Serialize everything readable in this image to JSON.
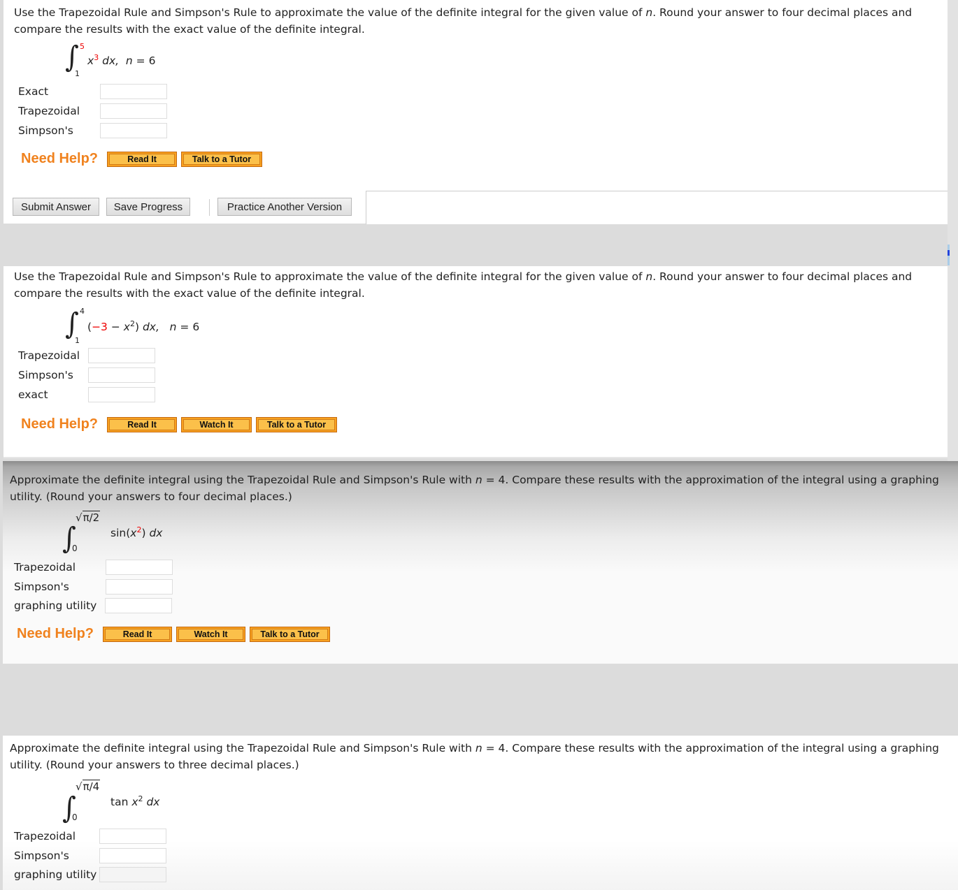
{
  "questions": [
    {
      "prompt_a": "Use the Trapezoidal Rule and Simpson's Rule to approximate the value of the definite integral for the given value of ",
      "prompt_n": "n",
      "prompt_b": ". Round your answer to four decimal places and compare the results with the exact value of the definite integral.",
      "integral": {
        "lower": "1",
        "upper": "5",
        "integrand_base": "x",
        "integrand_exp": "3",
        "dx": " dx,",
        "n_label": "n",
        "n_eq": " = 6"
      },
      "fields": [
        {
          "label": "Exact",
          "value": ""
        },
        {
          "label": "Trapezoidal",
          "value": ""
        },
        {
          "label": "Simpson's",
          "value": ""
        }
      ],
      "help": {
        "label": "Need Help?",
        "buttons": [
          "Read It",
          "Talk to a Tutor"
        ]
      },
      "actions": {
        "submit": "Submit Answer",
        "save": "Save Progress",
        "practice": "Practice Another Version"
      }
    },
    {
      "prompt_a": "Use the Trapezoidal Rule and Simpson's Rule to approximate the value of the definite integral for the given value of ",
      "prompt_n": "n",
      "prompt_b": ". Round your answer to four decimal places and compare the results with the exact value of the definite integral.",
      "integral": {
        "lower": "1",
        "upper": "4",
        "open": "(",
        "const": "−3",
        "minus": " − ",
        "base": "x",
        "exp": "2",
        "close": ")",
        "dx": " dx,",
        "n_label": "n",
        "n_eq": " = 6"
      },
      "fields": [
        {
          "label": "Trapezoidal",
          "value": ""
        },
        {
          "label": "Simpson's",
          "value": ""
        },
        {
          "label": "exact",
          "value": ""
        }
      ],
      "help": {
        "label": "Need Help?",
        "buttons": [
          "Read It",
          "Watch It",
          "Talk to a Tutor"
        ]
      }
    },
    {
      "prompt_a": "Approximate the definite integral using the Trapezoidal Rule and Simpson's Rule with ",
      "prompt_n": "n",
      "prompt_b": " = 4. Compare these results with the approximation of the integral using a graphing utility. (Round your answers to four decimal places.)",
      "integral": {
        "lower": "0",
        "upper_root": "√",
        "upper": "π/2",
        "func": "sin(",
        "base": "x",
        "exp": "2",
        "close": ")",
        "dx": " dx"
      },
      "fields": [
        {
          "label": "Trapezoidal",
          "value": ""
        },
        {
          "label": "Simpson's",
          "value": ""
        },
        {
          "label": "graphing utility",
          "value": ""
        }
      ],
      "help": {
        "label": "Need Help?",
        "buttons": [
          "Read It",
          "Watch It",
          "Talk to a Tutor"
        ]
      }
    },
    {
      "prompt_a": "Approximate the definite integral using the Trapezoidal Rule and Simpson's Rule with ",
      "prompt_n": "n",
      "prompt_b": " = 4. Compare these results with the approximation of the integral using a graphing utility. (Round your answers to three decimal places.)",
      "integral": {
        "lower": "0",
        "upper_root": "√",
        "upper": "π/4",
        "func": "tan ",
        "base": "x",
        "exp": "2",
        "dx": " dx"
      },
      "fields": [
        {
          "label": "Trapezoidal",
          "value": ""
        },
        {
          "label": "Simpson's",
          "value": ""
        },
        {
          "label": "graphing utility",
          "value": ""
        }
      ]
    }
  ],
  "colors": {
    "help_orange": "#f0821e",
    "button_orange": "#fbc04a",
    "exponent_red": "#e00000"
  }
}
